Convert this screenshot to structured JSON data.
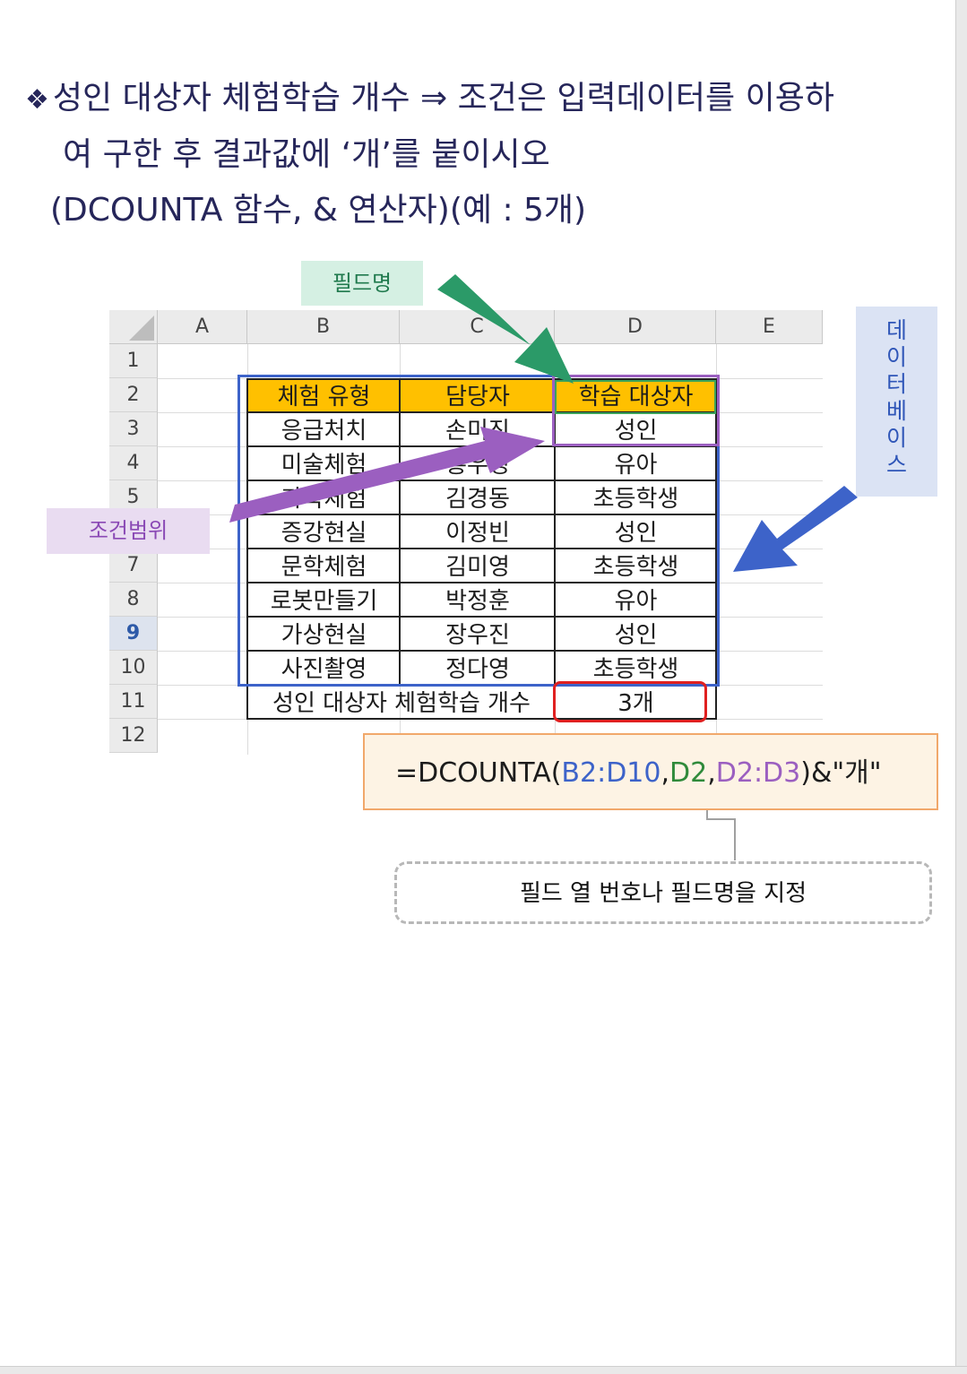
{
  "title": {
    "bullet_icon": "diamond-bullet-icon",
    "line1": "성인 대상자 체험학습 개수 ⇒ 조건은 입력데이터를 이용하",
    "line2": "여 구한 후 결과값에 ‘개’를 붙이시오",
    "line3": "(DCOUNTA 함수, & 연산자)(예 : 5개)"
  },
  "labels": {
    "field_name": "필드명",
    "condition_range": "조건범위",
    "database": [
      "데",
      "이",
      "터",
      "베",
      "이",
      "스"
    ]
  },
  "sheet": {
    "columns": [
      "A",
      "B",
      "C",
      "D",
      "E"
    ],
    "rows": [
      "1",
      "2",
      "3",
      "4",
      "5",
      "6",
      "7",
      "8",
      "9",
      "10",
      "11",
      "12"
    ],
    "selected_row": "9",
    "table": {
      "headers": [
        "체험 유형",
        "담당자",
        "학습 대상자"
      ],
      "rows": [
        [
          "응급처치",
          "손미진",
          "성인"
        ],
        [
          "미술체험",
          "홍우정",
          "유아"
        ],
        [
          "과학체험",
          "김경동",
          "초등학생"
        ],
        [
          "증강현실",
          "이정빈",
          "성인"
        ],
        [
          "문학체험",
          "김미영",
          "초등학생"
        ],
        [
          "로봇만들기",
          "박정훈",
          "유아"
        ],
        [
          "가상현실",
          "장우진",
          "성인"
        ],
        [
          "사진촬영",
          "정다영",
          "초등학생"
        ]
      ],
      "result_label": "성인 대상자 체험학습 개수",
      "result_value": "3개"
    },
    "header_fill_color": "#ffc000"
  },
  "formula": {
    "prefix": "=DCOUNTA(",
    "arg1": "B2:D10",
    "comma1": ",",
    "arg2": "D2",
    "comma2": ",",
    "arg3": "D2:D3",
    "suffix": ")&\"개\""
  },
  "note": "필드 열 번호나 필드명을 지정",
  "colors": {
    "database_blue": "#3d63c9",
    "field_green": "#2f8a3a",
    "condition_purple": "#9b5fc0",
    "result_red": "#e02020",
    "title_navy": "#26265a"
  }
}
